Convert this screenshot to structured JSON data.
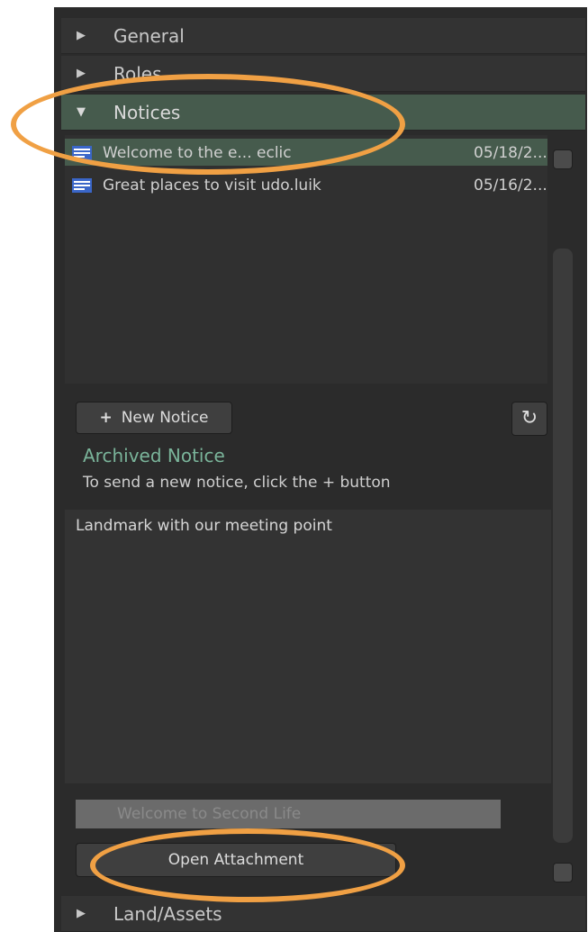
{
  "sections": {
    "general": "General",
    "roles": "Roles",
    "notices": "Notices",
    "land_assets": "Land/Assets"
  },
  "notices": [
    {
      "subject": "Welcome to the e... eclic",
      "date": "05/18/2...",
      "selected": true
    },
    {
      "subject": "Great places to visit udo.luik",
      "date": "05/16/2...",
      "selected": false
    }
  ],
  "toolbar": {
    "new_notice_label": "New Notice",
    "refresh_glyph": "↻"
  },
  "archived": {
    "title": "Archived Notice",
    "hint": "To send a new notice, click the + button"
  },
  "message": {
    "body": "Landmark with our meeting point"
  },
  "attachment": {
    "name": "Welcome to Second Life",
    "open_label": "Open Attachment"
  },
  "colors": {
    "annotation": "#f0a044",
    "selected_row": "#465b4d",
    "archived_title": "#7ab49a"
  }
}
